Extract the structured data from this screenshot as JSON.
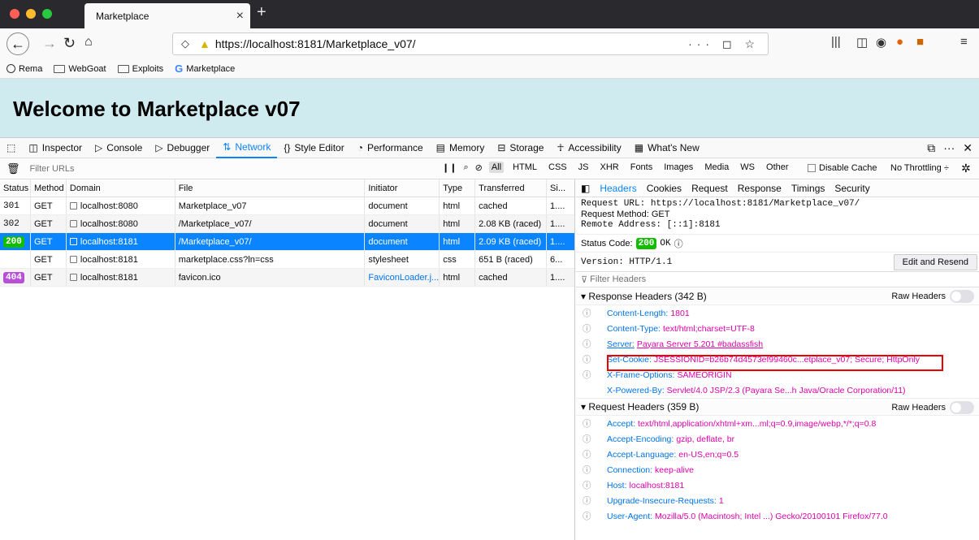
{
  "browser": {
    "tab_title": "Marketplace",
    "url": "https://localhost:8181/Marketplace_v07/",
    "bookmarks": [
      "Rema",
      "WebGoat",
      "Exploits",
      "Marketplace"
    ]
  },
  "page": {
    "heading": "Welcome to Marketplace v07"
  },
  "devtools": {
    "tabs": [
      "Inspector",
      "Console",
      "Debugger",
      "Network",
      "Style Editor",
      "Performance",
      "Memory",
      "Storage",
      "Accessibility",
      "What's New"
    ],
    "filter_placeholder": "Filter URLs",
    "type_filters": [
      "All",
      "HTML",
      "CSS",
      "JS",
      "XHR",
      "Fonts",
      "Images",
      "Media",
      "WS",
      "Other"
    ],
    "disable_cache": "Disable Cache",
    "throttling": "No Throttling ÷"
  },
  "table": {
    "headers": [
      "Status",
      "Method",
      "Domain",
      "File",
      "Initiator",
      "Type",
      "Transferred",
      "Si..."
    ],
    "rows": [
      {
        "status": "301",
        "method": "GET",
        "domain": "localhost:8080",
        "file": "Marketplace_v07",
        "initiator": "document",
        "type": "html",
        "transferred": "cached",
        "size": "1...."
      },
      {
        "status": "302",
        "method": "GET",
        "domain": "localhost:8080",
        "file": "/Marketplace_v07/",
        "initiator": "document",
        "type": "html",
        "transferred": "2.08 KB (raced)",
        "size": "1...."
      },
      {
        "status": "200",
        "method": "GET",
        "domain": "localhost:8181",
        "file": "/Marketplace_v07/",
        "initiator": "document",
        "type": "html",
        "transferred": "2.09 KB (raced)",
        "size": "1...."
      },
      {
        "status": "",
        "method": "GET",
        "domain": "localhost:8181",
        "file": "marketplace.css?ln=css",
        "initiator": "stylesheet",
        "type": "css",
        "transferred": "651 B (raced)",
        "size": "6..."
      },
      {
        "status": "404",
        "method": "GET",
        "domain": "localhost:8181",
        "file": "favicon.ico",
        "initiator": "FaviconLoader.j...",
        "type": "html",
        "transferred": "cached",
        "size": "1...."
      }
    ]
  },
  "details": {
    "tabs": [
      "Headers",
      "Cookies",
      "Request",
      "Response",
      "Timings",
      "Security"
    ],
    "request_url": "Request URL: https://localhost:8181/Marketplace_v07/",
    "request_method": "Request Method: GET",
    "remote_address": "Remote Address: [::1]:8181",
    "status_label": "Status Code:",
    "status_code": "200",
    "status_text": "OK",
    "version": "Version: HTTP/1.1",
    "edit_resend": "Edit and Resend",
    "filter_headers": "Filter Headers",
    "response_title": "Response Headers (342 B)",
    "request_title": "Request Headers (359 B)",
    "raw_headers": "Raw Headers",
    "response_headers": [
      {
        "k": "Content-Length:",
        "v": "1801",
        "q": true
      },
      {
        "k": "Content-Type:",
        "v": "text/html;charset=UTF-8",
        "q": true
      },
      {
        "k": "Server:",
        "v": "Payara Server 5.201 #badassfish",
        "q": true
      },
      {
        "k": "Set-Cookie:",
        "v": "JSESSIONID=b26b74d4573ef99460c...etplace_v07; Secure; HttpOnly",
        "q": true
      },
      {
        "k": "X-Frame-Options:",
        "v": "SAMEORIGIN",
        "q": true
      },
      {
        "k": "X-Powered-By:",
        "v": "Servlet/4.0 JSP/2.3 (Payara Se...h Java/Oracle Corporation/11)",
        "q": false
      }
    ],
    "request_headers": [
      {
        "k": "Accept:",
        "v": "text/html,application/xhtml+xm...ml;q=0.9,image/webp,*/*;q=0.8"
      },
      {
        "k": "Accept-Encoding:",
        "v": "gzip, deflate, br"
      },
      {
        "k": "Accept-Language:",
        "v": "en-US,en;q=0.5"
      },
      {
        "k": "Connection:",
        "v": "keep-alive"
      },
      {
        "k": "Host:",
        "v": "localhost:8181"
      },
      {
        "k": "Upgrade-Insecure-Requests:",
        "v": "1"
      },
      {
        "k": "User-Agent:",
        "v": "Mozilla/5.0 (Macintosh; Intel ...) Gecko/20100101 Firefox/77.0"
      }
    ]
  }
}
